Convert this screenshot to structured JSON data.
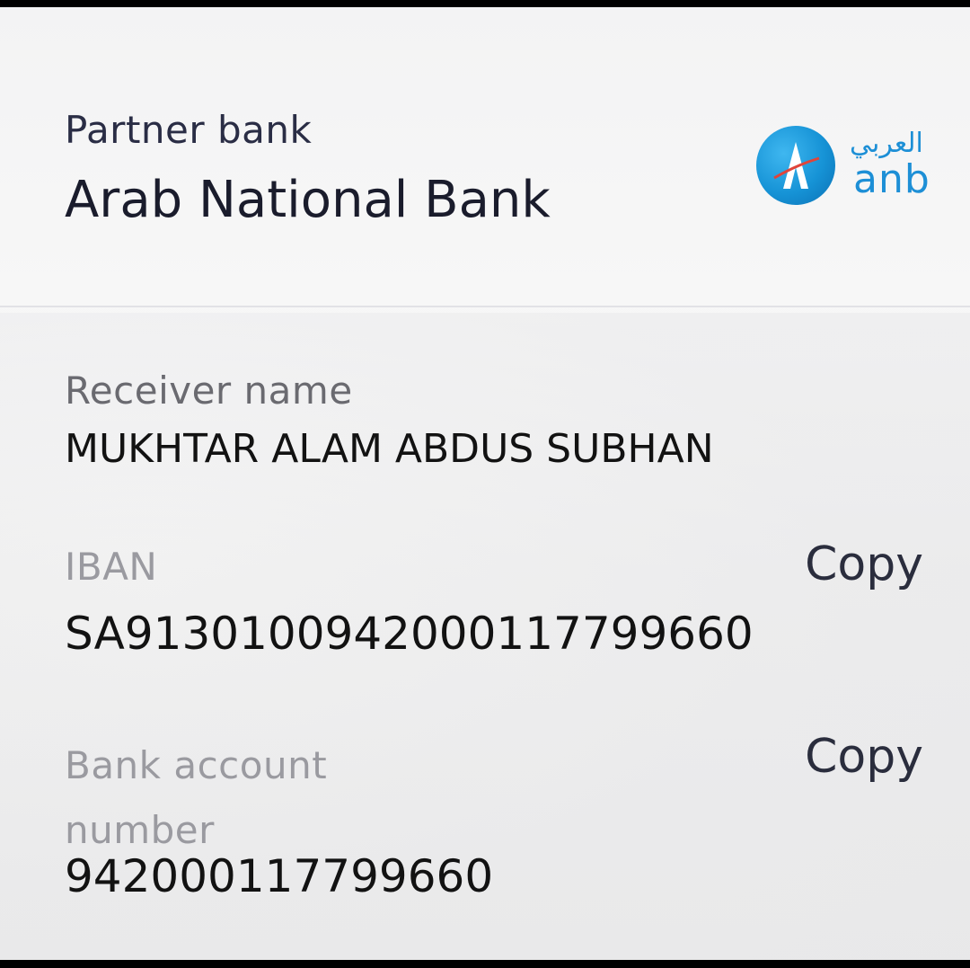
{
  "partner": {
    "label": "Partner bank",
    "bank_name": "Arab National Bank",
    "logo": {
      "icon": "anb-logo-icon",
      "arabic_text": "العربي",
      "latin_text": "anb",
      "color": "#1d8fd6"
    }
  },
  "receiver": {
    "label": "Receiver name",
    "value": "MUKHTAR ALAM ABDUS SUBHAN"
  },
  "iban": {
    "label": "IBAN",
    "value": "SA9130100942000117799660",
    "copy_label": "Copy"
  },
  "account": {
    "label": "Bank account number",
    "value": "942000117799660",
    "copy_label": "Copy"
  }
}
